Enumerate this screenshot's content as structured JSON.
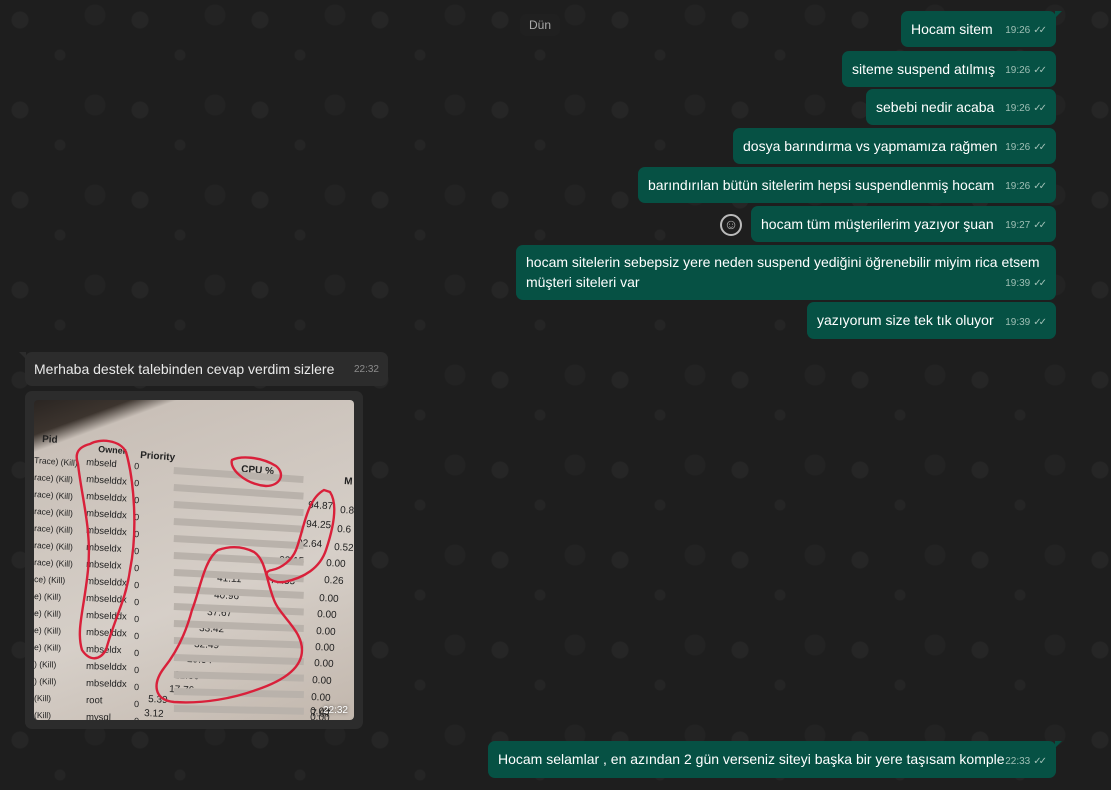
{
  "date_separator": "Dün",
  "outgoing": [
    {
      "text": "Hocam sitem",
      "time": "19:26"
    },
    {
      "text": "siteme suspend atılmış",
      "time": "19:26"
    },
    {
      "text": "sebebi nedir acaba",
      "time": "19:26"
    },
    {
      "text": "dosya barındırma vs yapmamıza rağmen",
      "time": "19:26"
    },
    {
      "text": "barındırılan bütün sitelerim hepsi suspendlenmiş hocam",
      "time": "19:26"
    },
    {
      "text": "hocam tüm müşterilerim yazıyor şuan",
      "time": "19:27"
    },
    {
      "text": "hocam sitelerin sebepsiz yere neden suspend yediğini öğrenebilir miyim rica etsem\nmüşteri siteleri var",
      "time": "19:39"
    },
    {
      "text": "yazıyorum size tek tık oluyor",
      "time": "19:39"
    },
    {
      "text": "Hocam selamlar , en azından 2 gün verseniz siteyi başka bir yere taşısam komple",
      "time": "22:33"
    }
  ],
  "incoming": [
    {
      "text": "Merhaba destek talebinden cevap verdim sizlere",
      "time": "22:32"
    }
  ],
  "photo": {
    "time": "22:32",
    "headers": {
      "pid": "Pid",
      "owner": "Owner",
      "priority": "Priority",
      "cpu": "CPU %",
      "m": "M"
    },
    "owners": [
      "mbseld",
      "mbselddx",
      "mbselddx",
      "mbselddx",
      "mbselddx",
      "mbseldx",
      "mbseldx",
      "mbselddx",
      "mbselddx",
      "mbselddx",
      "mbselddx",
      "mbseldx",
      "mbselddx",
      "mbselddx",
      "root",
      "mysql",
      "root",
      "smmedgkd"
    ],
    "pid_labels": [
      "Trace) (Kill)",
      "race) (Kill)",
      "race) (Kill)",
      "race) (Kill)",
      "race) (Kill)",
      "race) (Kill)",
      "race) (Kill)",
      "ce) (Kill)",
      "e) (Kill)",
      "e) (Kill)",
      "e) (Kill)",
      "e) (Kill)",
      ") (Kill)",
      ") (Kill)",
      "(Kill)",
      "(Kill)",
      "(Kill)",
      "(Kill)"
    ],
    "priority": [
      "0",
      "0",
      "0",
      "0",
      "0",
      "0",
      "0",
      "0",
      "0",
      "0",
      "0",
      "0",
      "0",
      "0",
      "0",
      "0",
      "0",
      "0"
    ],
    "cpu": [
      "94.87",
      "94.25",
      "92.64",
      "82.15",
      "77.55",
      "41.11",
      "40.96",
      "37.67",
      "33.42",
      "32.49",
      "29.04",
      "21.36",
      "17.76",
      "5.39",
      "3.12"
    ],
    "mem": [
      "0.8",
      "0.6",
      "0.52",
      "0.00",
      "0.26",
      "0.00",
      "0.00",
      "0.00",
      "0.00",
      "0.00",
      "0.00",
      "0.00",
      "0.00",
      "0.00",
      "0.00",
      "7.97"
    ]
  },
  "colors": {
    "outgoing_bubble": "#065144",
    "incoming_bubble": "#2c2c2c",
    "background": "#1e1e1e",
    "annotation": "#d9203a"
  }
}
